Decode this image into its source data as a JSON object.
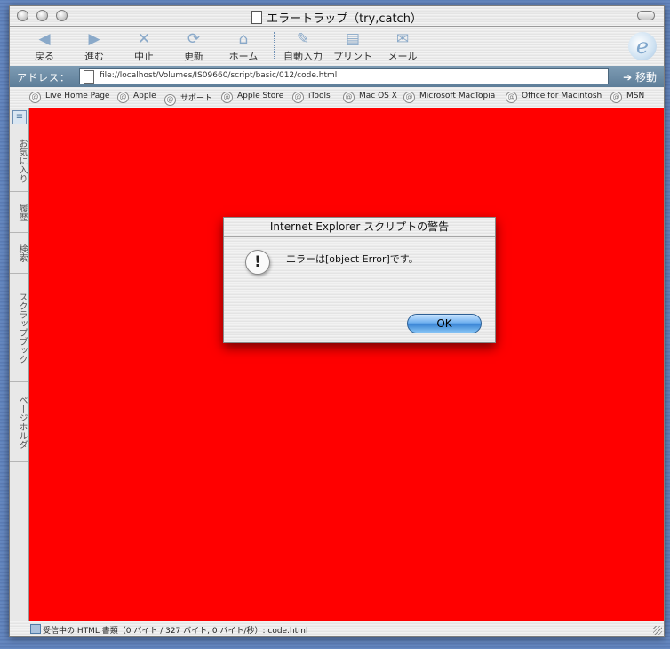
{
  "window": {
    "title": "エラートラップ（try,catch）"
  },
  "toolbar": {
    "back": "戻る",
    "forward": "進む",
    "stop": "中止",
    "refresh": "更新",
    "home": "ホーム",
    "autofill": "自動入力",
    "print": "プリント",
    "mail": "メール"
  },
  "address": {
    "label": "アドレス：",
    "url": "file://localhost/Volumes/IS09660/script/basic/012/code.html",
    "go": "移動"
  },
  "favorites": [
    "Live Home Page",
    "Apple",
    "サポート",
    "Apple Store",
    "iTools",
    "Mac OS X",
    "Microsoft MacTopia",
    "Office for Macintosh",
    "MSN"
  ],
  "sidebar": {
    "tabs": [
      "お気に入り",
      "履歴",
      "検索",
      "スクラップブック",
      "ページホルダ"
    ]
  },
  "page": {
    "background": "#ff0000"
  },
  "alert": {
    "title": "Internet Explorer スクリプトの警告",
    "message": "エラーは[object Error]です。",
    "ok": "OK"
  },
  "status": {
    "text": "受信中の HTML 書類（0 バイト / 327 バイト, 0 バイト/秒）: code.html"
  }
}
